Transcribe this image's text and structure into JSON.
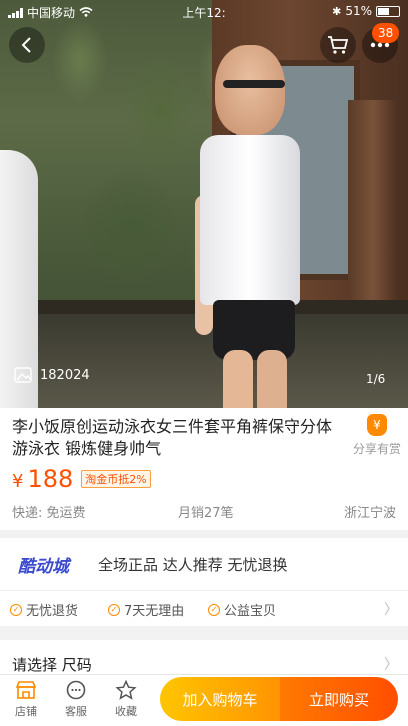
{
  "status_bar": {
    "carrier": "中国移动",
    "time": "上午12:",
    "battery": "51%"
  },
  "header": {
    "cart_badge": "38"
  },
  "gallery": {
    "view_count": "182024",
    "page_indicator": "1/6"
  },
  "product": {
    "title": "李小饭原创运动泳衣女三件套平角裤保守分体游泳衣 锻炼健身帅气",
    "share_label": "分享有赏",
    "currency": "¥",
    "price": "188",
    "coin_tag": "淘金币抵2%",
    "shipping": "快递: 免运费",
    "sales": "月销27笔",
    "location": "浙江宁波"
  },
  "promo": {
    "logo": "酷动城",
    "text": "全场正品 达人推荐 无忧退换"
  },
  "guarantees": [
    "无忧退货",
    "7天无理由",
    "公益宝贝"
  ],
  "spec": {
    "label": "请选择 尺码"
  },
  "bottom_bar": {
    "shop": "店铺",
    "service": "客服",
    "favorite": "收藏",
    "add_to_cart": "加入购物车",
    "buy_now": "立即购买"
  },
  "colors": {
    "accent": "#ff5000",
    "cart_gradient": [
      "#ffc500",
      "#ff9402"
    ],
    "buy_gradient": [
      "#ff7a00",
      "#ff4e00"
    ]
  }
}
